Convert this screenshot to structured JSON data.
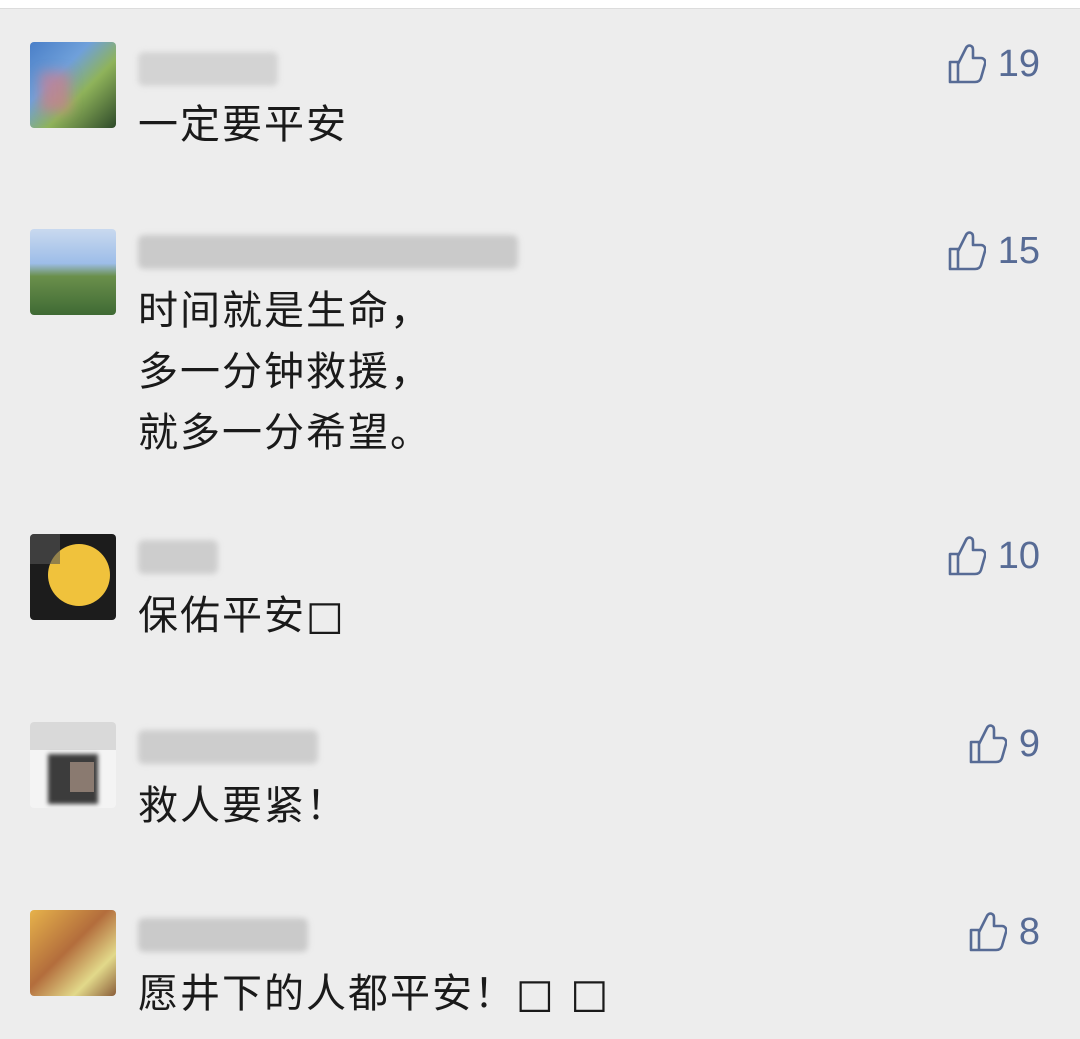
{
  "comments": [
    {
      "text": "一定要平安",
      "likes": "19",
      "avatar_colors": [
        "#4a7fc8",
        "#8fb35a",
        "#d27c8a",
        "#2e4a2a"
      ]
    },
    {
      "text": "时间就是生命，\n多一分钟救援，\n就多一分希望。",
      "likes": "15",
      "avatar_colors": [
        "#9dbde8",
        "#3f6a34",
        "#6a8f4b",
        "#c9d9ef"
      ]
    },
    {
      "text": "保佑平安□",
      "likes": "10",
      "avatar_colors": [
        "#1c1c1c",
        "#f0c23c",
        "#e7b43a",
        "#555555"
      ]
    },
    {
      "text": "救人要紧！",
      "likes": "9",
      "avatar_colors": [
        "#d9d9d9",
        "#3c3c3c",
        "#8a7a70",
        "#f4f4f4"
      ]
    },
    {
      "text": "愿井下的人都平安！□ □",
      "likes": "8",
      "avatar_colors": [
        "#e6b24b",
        "#b36d3c",
        "#e2d98a",
        "#8b5e3a"
      ]
    }
  ],
  "icons": {
    "like": "thumbs-up-icon"
  },
  "colors": {
    "background": "#ededed",
    "like_color": "#576b95",
    "text_color": "#1a1a1a"
  }
}
